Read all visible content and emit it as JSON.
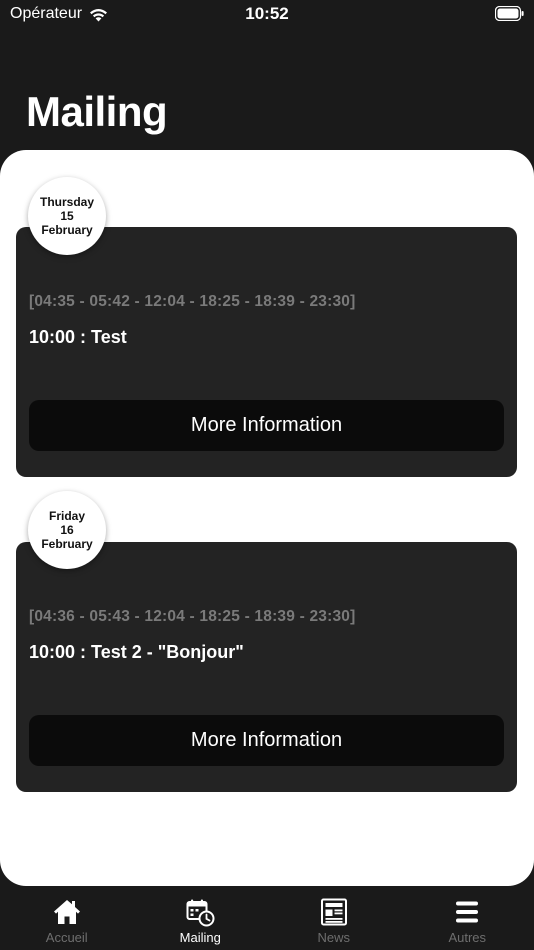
{
  "status_bar": {
    "carrier": "Opérateur",
    "time": "10:52"
  },
  "header": {
    "title": "Mailing"
  },
  "days": [
    {
      "weekday": "Thursday",
      "day": "15",
      "month": "February",
      "times": "[04:35 - 05:42 - 12:04 - 18:25 - 18:39 - 23:30]",
      "event": "10:00 : Test",
      "button_label": "More Information"
    },
    {
      "weekday": "Friday",
      "day": "16",
      "month": "February",
      "times": "[04:36 - 05:43 - 12:04 - 18:25 - 18:39 - 23:30]",
      "event": "10:00 : Test 2 - \"Bonjour\"",
      "button_label": "More Information"
    }
  ],
  "tab_bar": {
    "active": "Mailing",
    "tabs": [
      {
        "label": "Accueil",
        "icon": "home-icon"
      },
      {
        "label": "Mailing",
        "icon": "calendar-clock-icon"
      },
      {
        "label": "News",
        "icon": "newspaper-icon"
      },
      {
        "label": "Autres",
        "icon": "menu-icon"
      }
    ]
  },
  "colors": {
    "background": "#1a1a1a",
    "sheet": "#ffffff",
    "card": "#232323",
    "button": "#0b0b0b",
    "muted_text": "#7a7a7a",
    "inactive_tab": "#6e6e6e"
  }
}
